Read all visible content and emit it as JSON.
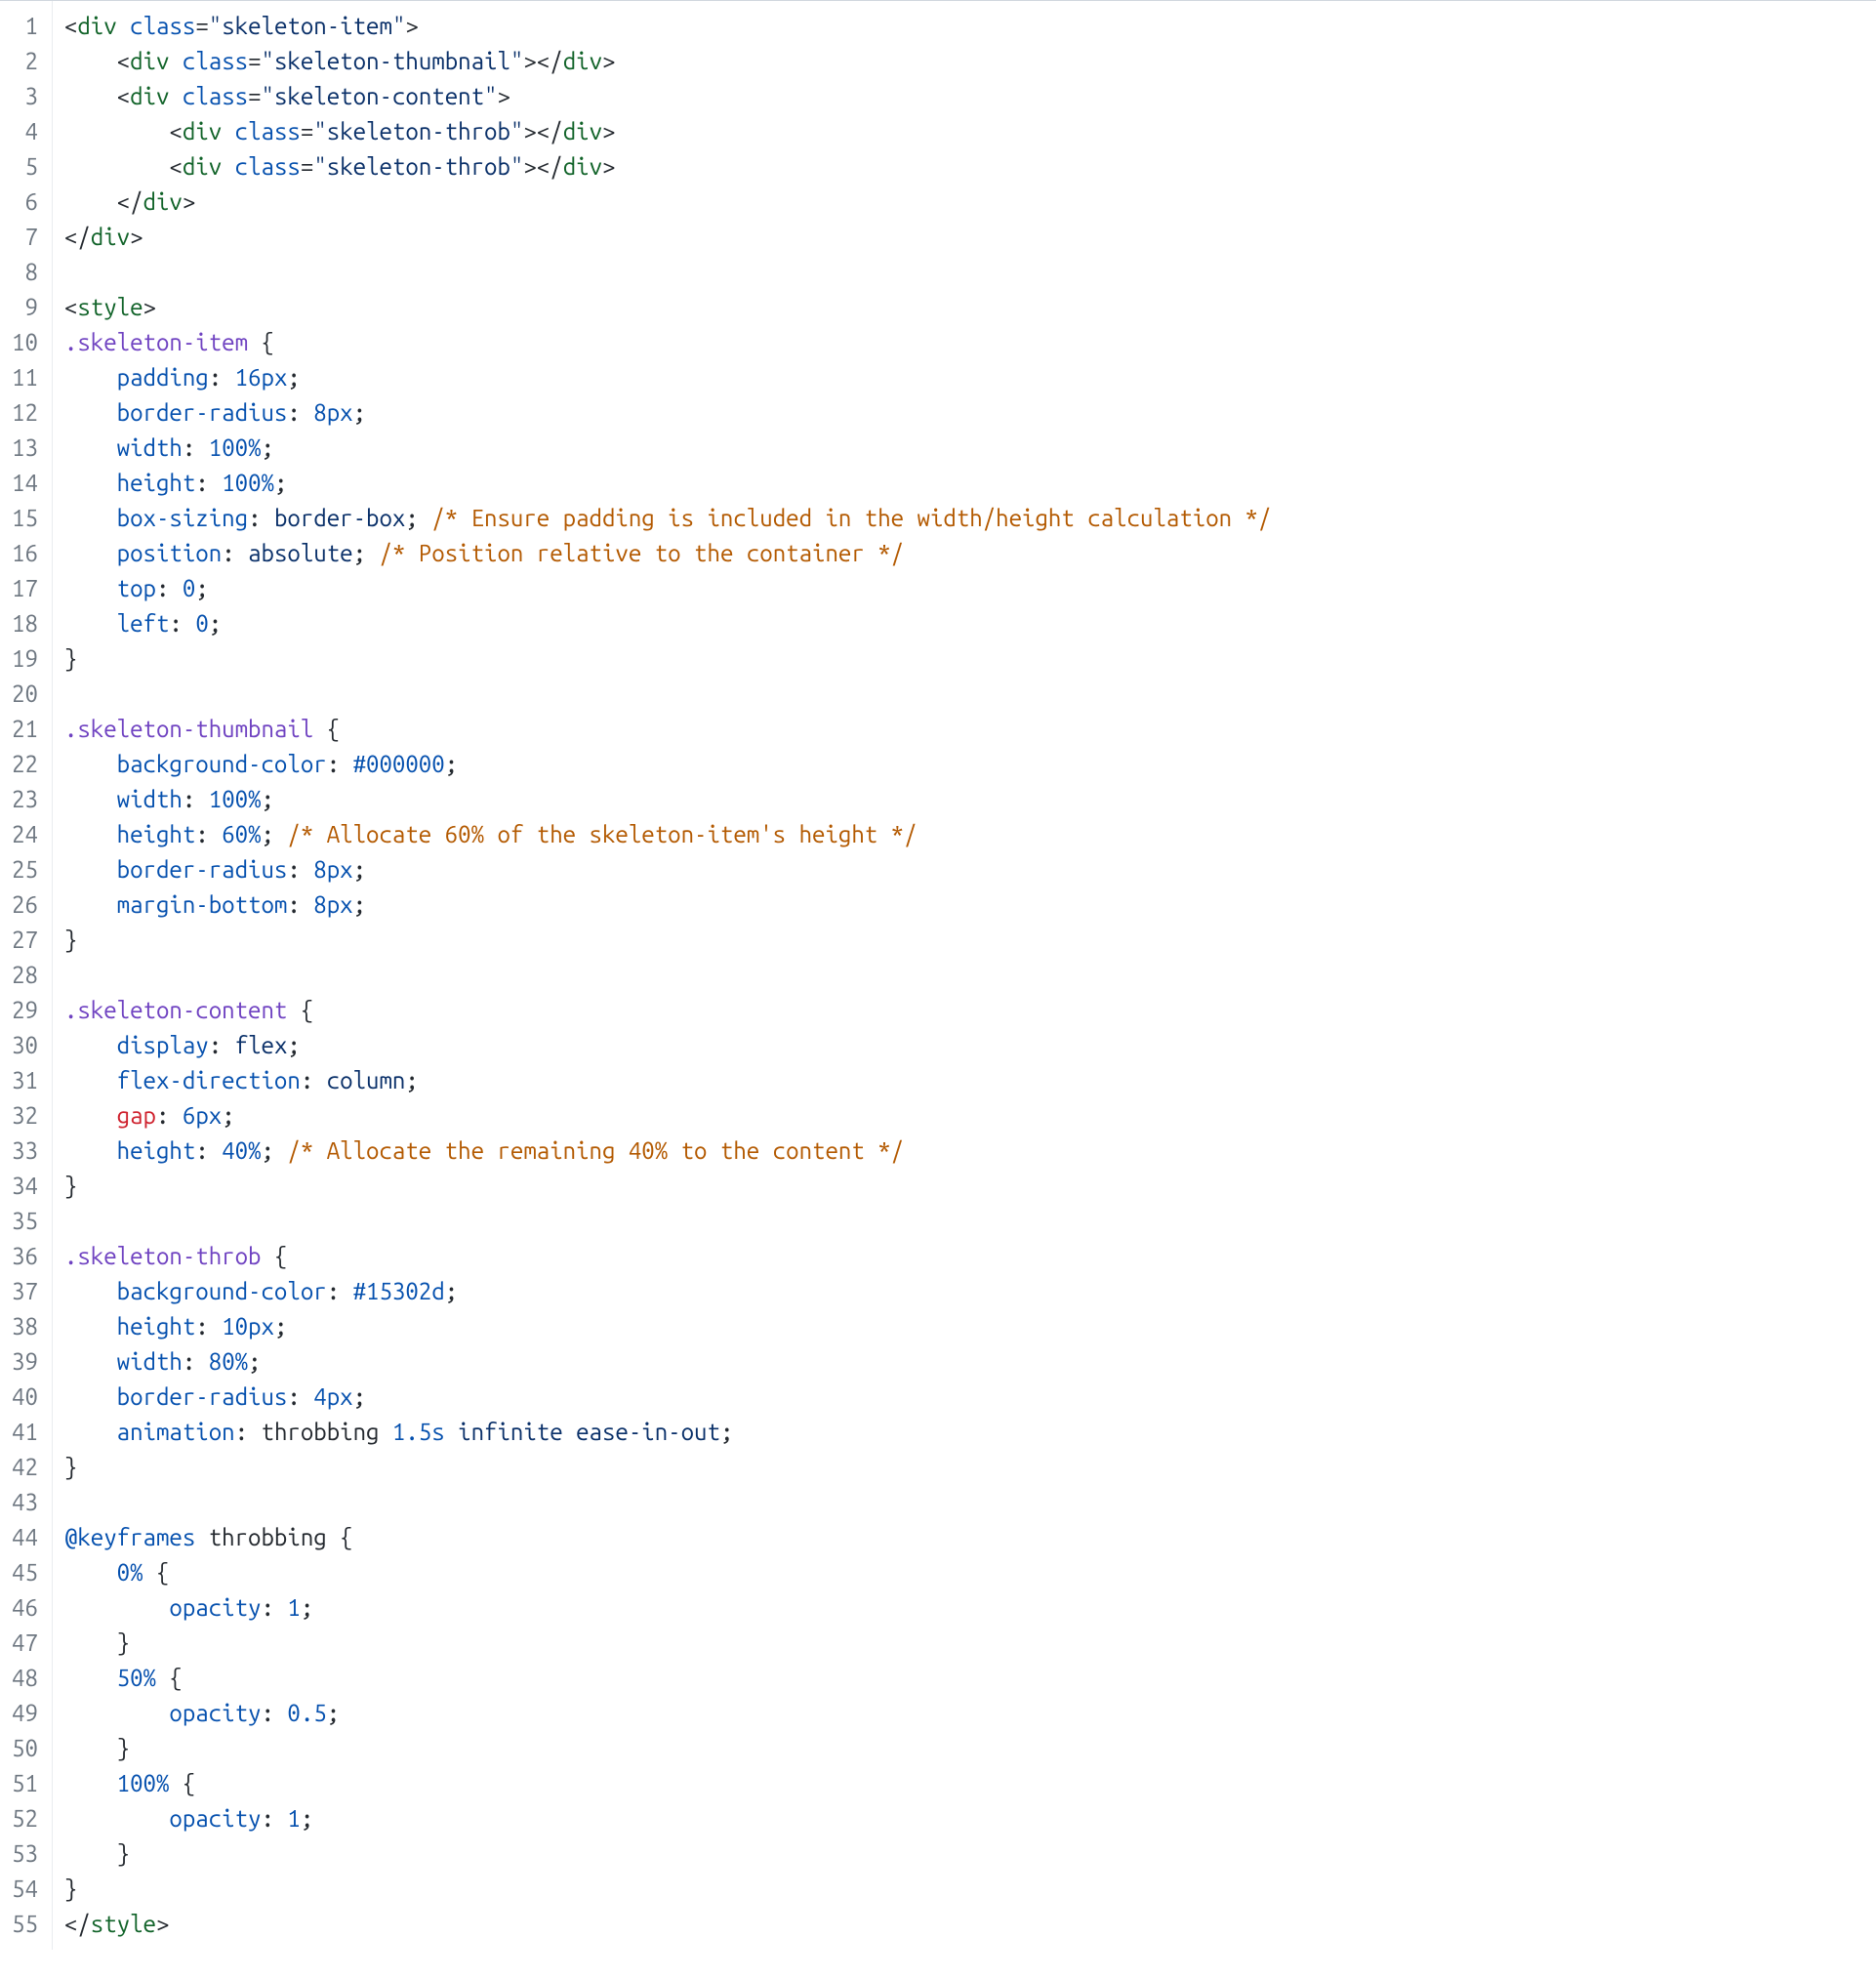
{
  "lines": [
    {
      "n": 1,
      "tokens": [
        [
          "<",
          "t-punc"
        ],
        [
          "div",
          "t-tag"
        ],
        [
          " ",
          "t-punc"
        ],
        [
          "class",
          "t-attr"
        ],
        [
          "=",
          "t-punc"
        ],
        [
          "\"skeleton-item\"",
          "t-str"
        ],
        [
          ">",
          "t-punc"
        ]
      ]
    },
    {
      "n": 2,
      "tokens": [
        [
          "    ",
          ""
        ],
        [
          "<",
          "t-punc"
        ],
        [
          "div",
          "t-tag"
        ],
        [
          " ",
          "t-punc"
        ],
        [
          "class",
          "t-attr"
        ],
        [
          "=",
          "t-punc"
        ],
        [
          "\"skeleton-thumbnail\"",
          "t-str"
        ],
        [
          "></",
          "t-punc"
        ],
        [
          "div",
          "t-tag"
        ],
        [
          ">",
          "t-punc"
        ]
      ]
    },
    {
      "n": 3,
      "tokens": [
        [
          "    ",
          ""
        ],
        [
          "<",
          "t-punc"
        ],
        [
          "div",
          "t-tag"
        ],
        [
          " ",
          "t-punc"
        ],
        [
          "class",
          "t-attr"
        ],
        [
          "=",
          "t-punc"
        ],
        [
          "\"skeleton-content\"",
          "t-str"
        ],
        [
          ">",
          "t-punc"
        ]
      ]
    },
    {
      "n": 4,
      "tokens": [
        [
          "        ",
          ""
        ],
        [
          "<",
          "t-punc"
        ],
        [
          "div",
          "t-tag"
        ],
        [
          " ",
          "t-punc"
        ],
        [
          "class",
          "t-attr"
        ],
        [
          "=",
          "t-punc"
        ],
        [
          "\"skeleton-throb\"",
          "t-str"
        ],
        [
          "></",
          "t-punc"
        ],
        [
          "div",
          "t-tag"
        ],
        [
          ">",
          "t-punc"
        ]
      ]
    },
    {
      "n": 5,
      "tokens": [
        [
          "        ",
          ""
        ],
        [
          "<",
          "t-punc"
        ],
        [
          "div",
          "t-tag"
        ],
        [
          " ",
          "t-punc"
        ],
        [
          "class",
          "t-attr"
        ],
        [
          "=",
          "t-punc"
        ],
        [
          "\"skeleton-throb\"",
          "t-str"
        ],
        [
          "></",
          "t-punc"
        ],
        [
          "div",
          "t-tag"
        ],
        [
          ">",
          "t-punc"
        ]
      ]
    },
    {
      "n": 6,
      "tokens": [
        [
          "    ",
          ""
        ],
        [
          "</",
          "t-punc"
        ],
        [
          "div",
          "t-tag"
        ],
        [
          ">",
          "t-punc"
        ]
      ]
    },
    {
      "n": 7,
      "tokens": [
        [
          "</",
          "t-punc"
        ],
        [
          "div",
          "t-tag"
        ],
        [
          ">",
          "t-punc"
        ]
      ]
    },
    {
      "n": 8,
      "tokens": []
    },
    {
      "n": 9,
      "tokens": [
        [
          "<",
          "t-punc"
        ],
        [
          "style",
          "t-tag"
        ],
        [
          ">",
          "t-punc"
        ]
      ]
    },
    {
      "n": 10,
      "tokens": [
        [
          ".skeleton-item",
          "t-sel"
        ],
        [
          " {",
          "t-punc"
        ]
      ]
    },
    {
      "n": 11,
      "tokens": [
        [
          "    ",
          ""
        ],
        [
          "padding",
          "t-attr"
        ],
        [
          ": ",
          "t-punc"
        ],
        [
          "16px",
          "t-num"
        ],
        [
          ";",
          "t-punc"
        ]
      ]
    },
    {
      "n": 12,
      "tokens": [
        [
          "    ",
          ""
        ],
        [
          "border-radius",
          "t-attr"
        ],
        [
          ": ",
          "t-punc"
        ],
        [
          "8px",
          "t-num"
        ],
        [
          ";",
          "t-punc"
        ]
      ]
    },
    {
      "n": 13,
      "tokens": [
        [
          "    ",
          ""
        ],
        [
          "width",
          "t-attr"
        ],
        [
          ": ",
          "t-punc"
        ],
        [
          "100%",
          "t-num"
        ],
        [
          ";",
          "t-punc"
        ]
      ]
    },
    {
      "n": 14,
      "tokens": [
        [
          "    ",
          ""
        ],
        [
          "height",
          "t-attr"
        ],
        [
          ": ",
          "t-punc"
        ],
        [
          "100%",
          "t-num"
        ],
        [
          ";",
          "t-punc"
        ]
      ]
    },
    {
      "n": 15,
      "tokens": [
        [
          "    ",
          ""
        ],
        [
          "box-sizing",
          "t-attr"
        ],
        [
          ": ",
          "t-punc"
        ],
        [
          "border-box",
          "t-str"
        ],
        [
          "; ",
          "t-punc"
        ],
        [
          "/* Ensure padding is included in the width/height calculation */",
          "t-cmt"
        ]
      ]
    },
    {
      "n": 16,
      "tokens": [
        [
          "    ",
          ""
        ],
        [
          "position",
          "t-attr"
        ],
        [
          ": ",
          "t-punc"
        ],
        [
          "absolute",
          "t-str"
        ],
        [
          "; ",
          "t-punc"
        ],
        [
          "/* Position relative to the container */",
          "t-cmt"
        ]
      ]
    },
    {
      "n": 17,
      "tokens": [
        [
          "    ",
          ""
        ],
        [
          "top",
          "t-attr"
        ],
        [
          ": ",
          "t-punc"
        ],
        [
          "0",
          "t-num"
        ],
        [
          ";",
          "t-punc"
        ]
      ]
    },
    {
      "n": 18,
      "tokens": [
        [
          "    ",
          ""
        ],
        [
          "left",
          "t-attr"
        ],
        [
          ": ",
          "t-punc"
        ],
        [
          "0",
          "t-num"
        ],
        [
          ";",
          "t-punc"
        ]
      ]
    },
    {
      "n": 19,
      "tokens": [
        [
          "}",
          "t-punc"
        ]
      ]
    },
    {
      "n": 20,
      "tokens": []
    },
    {
      "n": 21,
      "tokens": [
        [
          ".skeleton-thumbnail",
          "t-sel"
        ],
        [
          " {",
          "t-punc"
        ]
      ]
    },
    {
      "n": 22,
      "tokens": [
        [
          "    ",
          ""
        ],
        [
          "background-color",
          "t-attr"
        ],
        [
          ": ",
          "t-punc"
        ],
        [
          "#000000",
          "t-num"
        ],
        [
          ";",
          "t-punc"
        ]
      ]
    },
    {
      "n": 23,
      "tokens": [
        [
          "    ",
          ""
        ],
        [
          "width",
          "t-attr"
        ],
        [
          ": ",
          "t-punc"
        ],
        [
          "100%",
          "t-num"
        ],
        [
          ";",
          "t-punc"
        ]
      ]
    },
    {
      "n": 24,
      "tokens": [
        [
          "    ",
          ""
        ],
        [
          "height",
          "t-attr"
        ],
        [
          ": ",
          "t-punc"
        ],
        [
          "60%",
          "t-num"
        ],
        [
          "; ",
          "t-punc"
        ],
        [
          "/* Allocate 60% of the skeleton-item's height */",
          "t-cmt"
        ]
      ]
    },
    {
      "n": 25,
      "tokens": [
        [
          "    ",
          ""
        ],
        [
          "border-radius",
          "t-attr"
        ],
        [
          ": ",
          "t-punc"
        ],
        [
          "8px",
          "t-num"
        ],
        [
          ";",
          "t-punc"
        ]
      ]
    },
    {
      "n": 26,
      "tokens": [
        [
          "    ",
          ""
        ],
        [
          "margin-bottom",
          "t-attr"
        ],
        [
          ": ",
          "t-punc"
        ],
        [
          "8px",
          "t-num"
        ],
        [
          ";",
          "t-punc"
        ]
      ]
    },
    {
      "n": 27,
      "tokens": [
        [
          "}",
          "t-punc"
        ]
      ]
    },
    {
      "n": 28,
      "tokens": []
    },
    {
      "n": 29,
      "tokens": [
        [
          ".skeleton-content",
          "t-sel"
        ],
        [
          " {",
          "t-punc"
        ]
      ]
    },
    {
      "n": 30,
      "tokens": [
        [
          "    ",
          ""
        ],
        [
          "display",
          "t-attr"
        ],
        [
          ": ",
          "t-punc"
        ],
        [
          "flex",
          "t-str"
        ],
        [
          ";",
          "t-punc"
        ]
      ]
    },
    {
      "n": 31,
      "tokens": [
        [
          "    ",
          ""
        ],
        [
          "flex-direction",
          "t-attr"
        ],
        [
          ": ",
          "t-punc"
        ],
        [
          "column",
          "t-str"
        ],
        [
          ";",
          "t-punc"
        ]
      ]
    },
    {
      "n": 32,
      "tokens": [
        [
          "    ",
          ""
        ],
        [
          "gap",
          "t-err"
        ],
        [
          ": ",
          "t-punc"
        ],
        [
          "6px",
          "t-num"
        ],
        [
          ";",
          "t-punc"
        ]
      ]
    },
    {
      "n": 33,
      "tokens": [
        [
          "    ",
          ""
        ],
        [
          "height",
          "t-attr"
        ],
        [
          ": ",
          "t-punc"
        ],
        [
          "40%",
          "t-num"
        ],
        [
          "; ",
          "t-punc"
        ],
        [
          "/* Allocate the remaining 40% to the content */",
          "t-cmt"
        ]
      ]
    },
    {
      "n": 34,
      "tokens": [
        [
          "}",
          "t-punc"
        ]
      ]
    },
    {
      "n": 35,
      "tokens": []
    },
    {
      "n": 36,
      "tokens": [
        [
          ".skeleton-throb",
          "t-sel"
        ],
        [
          " {",
          "t-punc"
        ]
      ]
    },
    {
      "n": 37,
      "tokens": [
        [
          "    ",
          ""
        ],
        [
          "background-color",
          "t-attr"
        ],
        [
          ": ",
          "t-punc"
        ],
        [
          "#15302d",
          "t-num"
        ],
        [
          ";",
          "t-punc"
        ]
      ]
    },
    {
      "n": 38,
      "tokens": [
        [
          "    ",
          ""
        ],
        [
          "height",
          "t-attr"
        ],
        [
          ": ",
          "t-punc"
        ],
        [
          "10px",
          "t-num"
        ],
        [
          ";",
          "t-punc"
        ]
      ]
    },
    {
      "n": 39,
      "tokens": [
        [
          "    ",
          ""
        ],
        [
          "width",
          "t-attr"
        ],
        [
          ": ",
          "t-punc"
        ],
        [
          "80%",
          "t-num"
        ],
        [
          ";",
          "t-punc"
        ]
      ]
    },
    {
      "n": 40,
      "tokens": [
        [
          "    ",
          ""
        ],
        [
          "border-radius",
          "t-attr"
        ],
        [
          ": ",
          "t-punc"
        ],
        [
          "4px",
          "t-num"
        ],
        [
          ";",
          "t-punc"
        ]
      ]
    },
    {
      "n": 41,
      "tokens": [
        [
          "    ",
          ""
        ],
        [
          "animation",
          "t-attr"
        ],
        [
          ": ",
          "t-punc"
        ],
        [
          "throbbing ",
          "t-ident"
        ],
        [
          "1.5s",
          "t-num"
        ],
        [
          " infinite ease-in-out",
          "t-str"
        ],
        [
          ";",
          "t-punc"
        ]
      ]
    },
    {
      "n": 42,
      "tokens": [
        [
          "}",
          "t-punc"
        ]
      ]
    },
    {
      "n": 43,
      "tokens": []
    },
    {
      "n": 44,
      "tokens": [
        [
          "@keyframes",
          "t-selkw"
        ],
        [
          " throbbing",
          " t-ident"
        ],
        [
          " {",
          "t-punc"
        ]
      ]
    },
    {
      "n": 45,
      "tokens": [
        [
          "    ",
          ""
        ],
        [
          "0%",
          "t-num"
        ],
        [
          " {",
          "t-punc"
        ]
      ]
    },
    {
      "n": 46,
      "tokens": [
        [
          "        ",
          ""
        ],
        [
          "opacity",
          "t-attr"
        ],
        [
          ": ",
          "t-punc"
        ],
        [
          "1",
          "t-num"
        ],
        [
          ";",
          "t-punc"
        ]
      ]
    },
    {
      "n": 47,
      "tokens": [
        [
          "    ",
          ""
        ],
        [
          "}",
          "t-punc"
        ]
      ]
    },
    {
      "n": 48,
      "tokens": [
        [
          "    ",
          ""
        ],
        [
          "50%",
          "t-num"
        ],
        [
          " {",
          "t-punc"
        ]
      ]
    },
    {
      "n": 49,
      "tokens": [
        [
          "        ",
          ""
        ],
        [
          "opacity",
          "t-attr"
        ],
        [
          ": ",
          "t-punc"
        ],
        [
          "0.5",
          "t-num"
        ],
        [
          ";",
          "t-punc"
        ]
      ]
    },
    {
      "n": 50,
      "tokens": [
        [
          "    ",
          ""
        ],
        [
          "}",
          "t-punc"
        ]
      ]
    },
    {
      "n": 51,
      "tokens": [
        [
          "    ",
          ""
        ],
        [
          "100%",
          "t-num"
        ],
        [
          " {",
          "t-punc"
        ]
      ]
    },
    {
      "n": 52,
      "tokens": [
        [
          "        ",
          ""
        ],
        [
          "opacity",
          "t-attr"
        ],
        [
          ": ",
          "t-punc"
        ],
        [
          "1",
          "t-num"
        ],
        [
          ";",
          "t-punc"
        ]
      ]
    },
    {
      "n": 53,
      "tokens": [
        [
          "    ",
          ""
        ],
        [
          "}",
          "t-punc"
        ]
      ]
    },
    {
      "n": 54,
      "tokens": [
        [
          "}",
          "t-punc"
        ]
      ]
    },
    {
      "n": 55,
      "tokens": [
        [
          "</",
          "t-punc"
        ],
        [
          "style",
          "t-tag"
        ],
        [
          ">",
          "t-punc"
        ]
      ]
    }
  ]
}
